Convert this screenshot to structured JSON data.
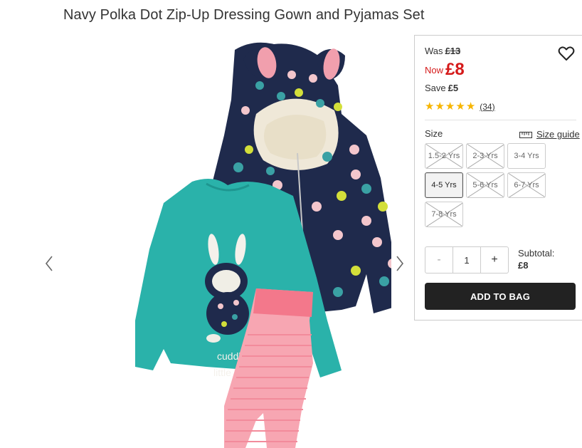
{
  "product": {
    "title": "Navy Polka Dot Zip-Up Dressing Gown and Pyjamas Set",
    "image_alt": "Navy polka dot hooded dressing gown with bunny ears, teal long-sleeve top with bunny print reading 'cuddly little bunny', pink striped pyjama bottoms"
  },
  "pricing": {
    "was_label": "Was",
    "was_value": "£13",
    "now_label": "Now",
    "now_value": "£8",
    "save_label": "Save",
    "save_value": "£5",
    "now_color": "#d51a1a"
  },
  "rating": {
    "stars": 5,
    "max_stars": 5,
    "review_count": "(34)",
    "star_color": "#f7b500"
  },
  "size": {
    "label": "Size",
    "guide_label": "Size guide",
    "options": [
      {
        "label": "1.5-2 Yrs",
        "available": false,
        "selected": false
      },
      {
        "label": "2-3 Yrs",
        "available": false,
        "selected": false
      },
      {
        "label": "3-4 Yrs",
        "available": true,
        "selected": false
      },
      {
        "label": "4-5 Yrs",
        "available": true,
        "selected": true
      },
      {
        "label": "5-6 Yrs",
        "available": false,
        "selected": false
      },
      {
        "label": "6-7 Yrs",
        "available": false,
        "selected": false
      },
      {
        "label": "7-8 Yrs",
        "available": false,
        "selected": false
      }
    ]
  },
  "quantity": {
    "minus": "-",
    "value": "1",
    "plus": "+"
  },
  "subtotal": {
    "label": "Subtotal:",
    "value": "£8"
  },
  "cta": {
    "add_to_bag": "ADD TO BAG",
    "color": "#222222"
  }
}
